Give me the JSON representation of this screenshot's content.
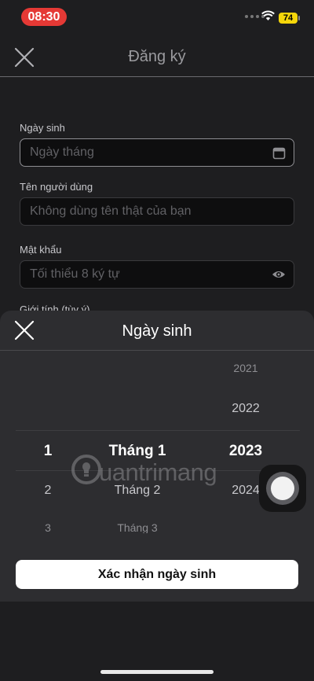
{
  "status_bar": {
    "time": "08:30",
    "battery": "74"
  },
  "header": {
    "title": "Đăng ký"
  },
  "form": {
    "birthday_label": "Ngày sinh",
    "birthday_placeholder": "Ngày tháng",
    "username_label": "Tên người dùng",
    "username_placeholder": "Không dùng tên thật của bạn",
    "password_label": "Mật khẩu",
    "password_placeholder": "Tối thiểu 8 ký tự",
    "gender_label": "Giới tính (tùy ý)"
  },
  "sheet": {
    "title": "Ngày sinh",
    "day_column": [
      "1",
      "2",
      "3"
    ],
    "month_column": [
      "Tháng 1",
      "Tháng 2",
      "Tháng 3"
    ],
    "year_column": [
      "2021",
      "2022",
      "2023",
      "2024"
    ],
    "selected_day": "1",
    "selected_month": "Tháng 1",
    "selected_year": "2023",
    "confirm_label": "Xác nhận ngày sinh"
  },
  "watermark": {
    "text": "uantrimang"
  },
  "icons": [
    "close-icon",
    "calendar-icon",
    "eye-icon",
    "wifi-icon",
    "lightbulb-icon"
  ]
}
